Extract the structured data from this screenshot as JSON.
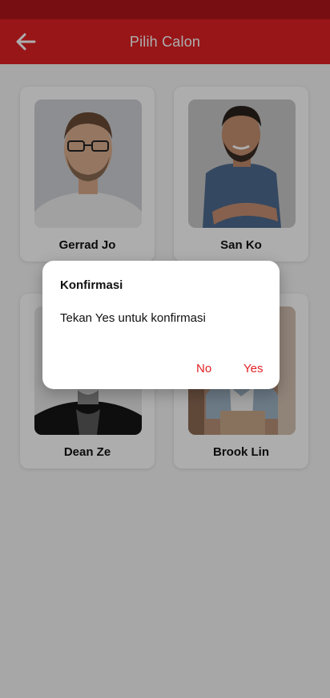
{
  "app_bar": {
    "title": "Pilih Calon"
  },
  "candidates": [
    {
      "name": "Gerrad Jo"
    },
    {
      "name": "San Ko"
    },
    {
      "name": "Dean Ze"
    },
    {
      "name": "Brook Lin"
    }
  ],
  "dialog": {
    "title": "Konfirmasi",
    "message": "Tekan Yes untuk konfirmasi",
    "no_label": "No",
    "yes_label": "Yes"
  },
  "colors": {
    "primary": "#e02124",
    "status_bar": "#b0161b"
  }
}
